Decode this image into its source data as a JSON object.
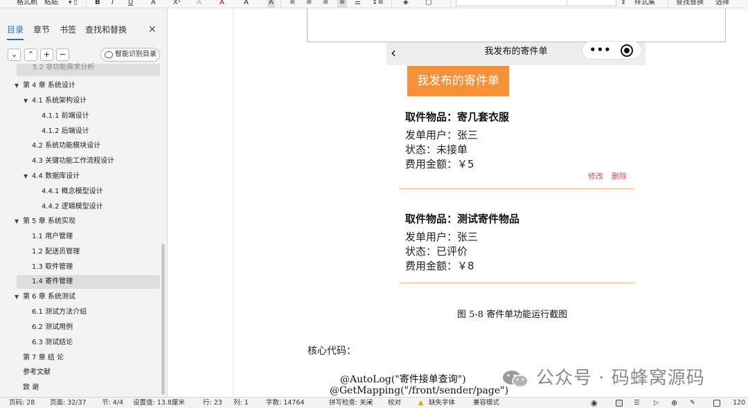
{
  "toolbar": {
    "items": [
      "格式刷",
      "粘贴",
      "B",
      "I",
      "U",
      "A",
      "X²",
      "A",
      "A",
      "A",
      "样式集",
      "查找替换",
      "选择"
    ]
  },
  "sidebar": {
    "tabs": [
      "目录",
      "章节",
      "书签",
      "查找和替换"
    ],
    "close": "✕",
    "controls": [
      "⌄",
      "⌃",
      "+",
      "−"
    ],
    "smart_button": "智能识别目录",
    "toc": [
      {
        "label": "5.2  非功能需求分析"
      },
      {
        "label": "第 4 章  系统设计"
      },
      {
        "label": "4.1    系统架构设计"
      },
      {
        "label": "4.1.1    前端设计"
      },
      {
        "label": "4.1.2    后端设计"
      },
      {
        "label": "4.2    系统功能模块设计"
      },
      {
        "label": "4.3    关键功能工作流程设计"
      },
      {
        "label": "4.4    数据库设计"
      },
      {
        "label": "4.4.1    概念模型设计"
      },
      {
        "label": "4.4.2    逻辑模型设计"
      },
      {
        "label": "第 5 章  系统实现"
      },
      {
        "label": "1.1  用户管理"
      },
      {
        "label": "1.2  配送员管理"
      },
      {
        "label": "1.3  取件管理"
      },
      {
        "label": "1.4  寄件管理"
      },
      {
        "label": "第 6 章  系统测试"
      },
      {
        "label": "6.1    测试方法介绍"
      },
      {
        "label": "6.2    测试用例"
      },
      {
        "label": "6.3    测试结论"
      },
      {
        "label": "第 7 章    结      论"
      },
      {
        "label": "参考文献"
      },
      {
        "label": "致      谢"
      }
    ]
  },
  "phone": {
    "nav_title": "我发布的寄件单",
    "dots": "•••",
    "banner": "我发布的寄件单",
    "cards": [
      {
        "item": "取件物品：寄几套衣服",
        "user": "发单用户：张三",
        "status": "状态：未接单",
        "fee": "费用金额：￥5",
        "edit": "修改",
        "delete": "删除"
      },
      {
        "item": "取件物品：测试寄件物品",
        "user": "发单用户：张三",
        "status": "状态：已评价",
        "fee": "费用金额：￥8"
      }
    ]
  },
  "document": {
    "caption": "图 5-8  寄件单功能运行截图",
    "core_code_label": "核心代码：",
    "code_lines": [
      "@AutoLog(\"寄件接单查询\")",
      "@GetMapping(\"/front/sender/page\")"
    ]
  },
  "watermark": {
    "text": "公众号 · 码蜂窝源码"
  },
  "statusbar": {
    "page_no": "页码: 28",
    "pages": "页面: 32/37",
    "section": "节: 4/4",
    "setting": "设置值: 13.8厘米",
    "row": "行: 23",
    "col": "列: 1",
    "word_count": "字数: 14764",
    "spell_check": "拼写检查: 关闭",
    "proof": "校对",
    "missing_font": "缺失字体",
    "compat": "兼容模式",
    "zoom": "120"
  }
}
